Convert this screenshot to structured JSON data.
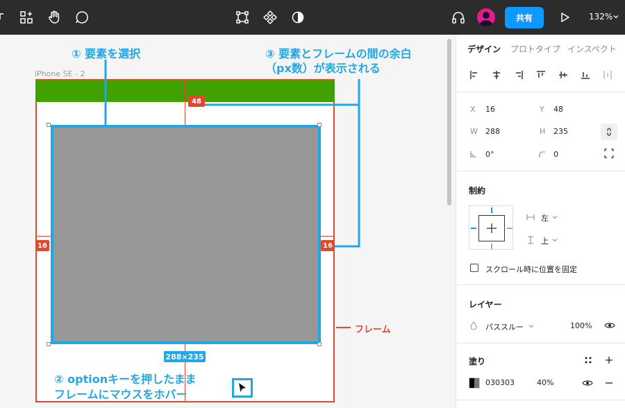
{
  "toolbar": {
    "share_label": "共有",
    "zoom_label": "132%",
    "icons": [
      "menu-icon",
      "components-icon",
      "hand-tool-icon",
      "comment-icon",
      "frame-icon",
      "component-icon",
      "theme-icon",
      "headphones-icon",
      "play-icon"
    ]
  },
  "canvas": {
    "frame_name": "iPhone SE - 2",
    "gap_top": "48",
    "gap_left": "16",
    "gap_right": "16",
    "size_label": "288×235",
    "frame_callout": "フレーム",
    "callout_1": "① 要素を選択",
    "callout_2_line1": "② optionキーを押したまま",
    "callout_2_line2": "フレームにマウスをホバー",
    "callout_3_line1": "③ 要素とフレームの間の余白",
    "callout_3_line2": "（px数）が表示される",
    "colors": {
      "accent": "#20a7e6",
      "frame": "#e4482a",
      "header": "#41a100",
      "selection_fill": "#979797"
    }
  },
  "panel": {
    "tabs": [
      "デザイン",
      "プロトタイプ",
      "インスペクト"
    ],
    "active_tab": "デザイン",
    "position": {
      "x_label": "X",
      "x_value": "16",
      "y_label": "Y",
      "y_value": "48"
    },
    "size": {
      "w_label": "W",
      "w_value": "288",
      "h_label": "H",
      "h_value": "235"
    },
    "rotation_value": "0°",
    "radius_value": "0",
    "constraints": {
      "title": "制約",
      "horizontal": "左",
      "vertical": "上",
      "fix_scroll_label": "スクロール時に位置を固定"
    },
    "layer": {
      "title": "レイヤー",
      "blend_mode": "パススルー",
      "opacity": "100%"
    },
    "fill": {
      "title": "塗り",
      "hex": "030303",
      "opacity": "40%"
    }
  }
}
